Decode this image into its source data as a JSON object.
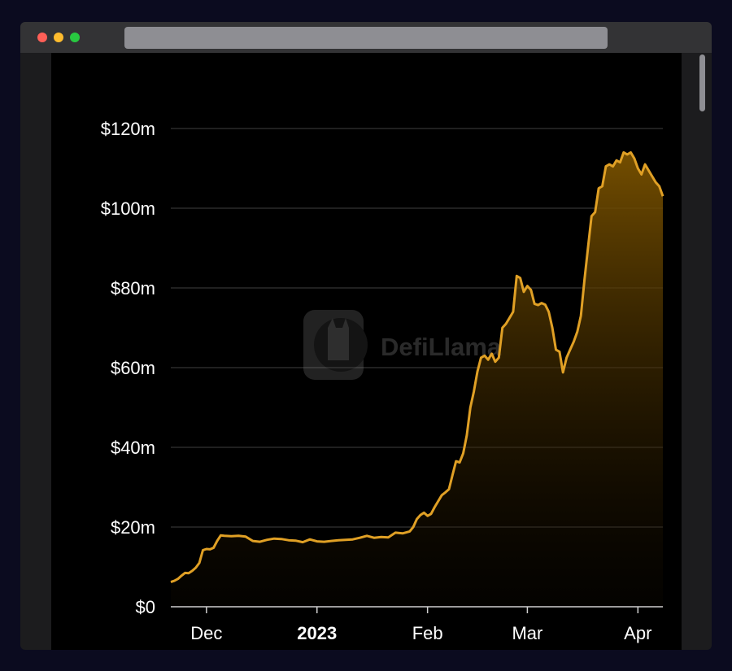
{
  "window": {
    "url": "",
    "controls": [
      "close",
      "minimize",
      "zoom"
    ]
  },
  "watermark": {
    "text": "DefiLlama",
    "logo_icon": "llama-logo-icon"
  },
  "colors": {
    "line": "#e0a025",
    "area_top": "#7a5200",
    "background": "#000000",
    "grid": "#2a2a2a",
    "text": "#ffffff"
  },
  "chart_data": {
    "type": "area",
    "title": "",
    "xlabel": "",
    "ylabel": "",
    "ylim": [
      0,
      120000000
    ],
    "xlim": [
      "2022-11-21",
      "2023-04-08"
    ],
    "grid": true,
    "legend": "none",
    "y_ticks": [
      {
        "value": 0,
        "label": "$0"
      },
      {
        "value": 20000000,
        "label": "$20m"
      },
      {
        "value": 40000000,
        "label": "$40m"
      },
      {
        "value": 60000000,
        "label": "$60m"
      },
      {
        "value": 80000000,
        "label": "$80m"
      },
      {
        "value": 100000000,
        "label": "$100m"
      },
      {
        "value": 120000000,
        "label": "$120m"
      }
    ],
    "x_ticks": [
      {
        "date": "2022-12-01",
        "label": "Dec",
        "bold": false
      },
      {
        "date": "2023-01-01",
        "label": "2023",
        "bold": true
      },
      {
        "date": "2023-02-01",
        "label": "Feb",
        "bold": false
      },
      {
        "date": "2023-03-01",
        "label": "Mar",
        "bold": false
      },
      {
        "date": "2023-04-01",
        "label": "Apr",
        "bold": false
      }
    ],
    "series": [
      {
        "points": [
          [
            "2022-11-21",
            6200000
          ],
          [
            "2022-11-22",
            6500000
          ],
          [
            "2022-11-23",
            7000000
          ],
          [
            "2022-11-24",
            7800000
          ],
          [
            "2022-11-25",
            8500000
          ],
          [
            "2022-11-26",
            8400000
          ],
          [
            "2022-11-27",
            9000000
          ],
          [
            "2022-11-28",
            9800000
          ],
          [
            "2022-11-29",
            11000000
          ],
          [
            "2022-11-30",
            14200000
          ],
          [
            "2022-12-01",
            14500000
          ],
          [
            "2022-12-02",
            14400000
          ],
          [
            "2022-12-03",
            14800000
          ],
          [
            "2022-12-04",
            16500000
          ],
          [
            "2022-12-05",
            17900000
          ],
          [
            "2022-12-06",
            17800000
          ],
          [
            "2022-12-08",
            17700000
          ],
          [
            "2022-12-10",
            17800000
          ],
          [
            "2022-12-12",
            17600000
          ],
          [
            "2022-12-14",
            16500000
          ],
          [
            "2022-12-16",
            16300000
          ],
          [
            "2022-12-18",
            16800000
          ],
          [
            "2022-12-20",
            17100000
          ],
          [
            "2022-12-22",
            17000000
          ],
          [
            "2022-12-24",
            16700000
          ],
          [
            "2022-12-26",
            16600000
          ],
          [
            "2022-12-28",
            16200000
          ],
          [
            "2022-12-30",
            16900000
          ],
          [
            "2023-01-01",
            16400000
          ],
          [
            "2023-01-03",
            16300000
          ],
          [
            "2023-01-05",
            16500000
          ],
          [
            "2023-01-07",
            16700000
          ],
          [
            "2023-01-09",
            16800000
          ],
          [
            "2023-01-11",
            16900000
          ],
          [
            "2023-01-13",
            17300000
          ],
          [
            "2023-01-15",
            17800000
          ],
          [
            "2023-01-17",
            17300000
          ],
          [
            "2023-01-19",
            17500000
          ],
          [
            "2023-01-21",
            17400000
          ],
          [
            "2023-01-23",
            18600000
          ],
          [
            "2023-01-25",
            18400000
          ],
          [
            "2023-01-27",
            18900000
          ],
          [
            "2023-01-28",
            20000000
          ],
          [
            "2023-01-29",
            22000000
          ],
          [
            "2023-01-30",
            23000000
          ],
          [
            "2023-01-31",
            23600000
          ],
          [
            "2023-02-01",
            22800000
          ],
          [
            "2023-02-02",
            23300000
          ],
          [
            "2023-02-03",
            25000000
          ],
          [
            "2023-02-04",
            26500000
          ],
          [
            "2023-02-05",
            28000000
          ],
          [
            "2023-02-06",
            28700000
          ],
          [
            "2023-02-07",
            29500000
          ],
          [
            "2023-02-08",
            33000000
          ],
          [
            "2023-02-09",
            36500000
          ],
          [
            "2023-02-10",
            36200000
          ],
          [
            "2023-02-11",
            38500000
          ],
          [
            "2023-02-12",
            43000000
          ],
          [
            "2023-02-13",
            50000000
          ],
          [
            "2023-02-14",
            54000000
          ],
          [
            "2023-02-15",
            59000000
          ],
          [
            "2023-02-16",
            62500000
          ],
          [
            "2023-02-17",
            63000000
          ],
          [
            "2023-02-18",
            62000000
          ],
          [
            "2023-02-19",
            63500000
          ],
          [
            "2023-02-20",
            61500000
          ],
          [
            "2023-02-21",
            62500000
          ],
          [
            "2023-02-22",
            70000000
          ],
          [
            "2023-02-23",
            71000000
          ],
          [
            "2023-02-24",
            72500000
          ],
          [
            "2023-02-25",
            74000000
          ],
          [
            "2023-02-26",
            83000000
          ],
          [
            "2023-02-27",
            82500000
          ],
          [
            "2023-02-28",
            79000000
          ],
          [
            "2023-03-01",
            80500000
          ],
          [
            "2023-03-02",
            79500000
          ],
          [
            "2023-03-03",
            76000000
          ],
          [
            "2023-03-04",
            75700000
          ],
          [
            "2023-03-05",
            76200000
          ],
          [
            "2023-03-06",
            75800000
          ],
          [
            "2023-03-07",
            74000000
          ],
          [
            "2023-03-08",
            70000000
          ],
          [
            "2023-03-09",
            64500000
          ],
          [
            "2023-03-10",
            64000000
          ],
          [
            "2023-03-11",
            58800000
          ],
          [
            "2023-03-12",
            62500000
          ],
          [
            "2023-03-13",
            64500000
          ],
          [
            "2023-03-14",
            66500000
          ],
          [
            "2023-03-15",
            69000000
          ],
          [
            "2023-03-16",
            73000000
          ],
          [
            "2023-03-17",
            82000000
          ],
          [
            "2023-03-18",
            90000000
          ],
          [
            "2023-03-19",
            98000000
          ],
          [
            "2023-03-20",
            99000000
          ],
          [
            "2023-03-21",
            105000000
          ],
          [
            "2023-03-22",
            105500000
          ],
          [
            "2023-03-23",
            110500000
          ],
          [
            "2023-03-24",
            111000000
          ],
          [
            "2023-03-25",
            110500000
          ],
          [
            "2023-03-26",
            112000000
          ],
          [
            "2023-03-27",
            111500000
          ],
          [
            "2023-03-28",
            114000000
          ],
          [
            "2023-03-29",
            113500000
          ],
          [
            "2023-03-30",
            114000000
          ],
          [
            "2023-03-31",
            112500000
          ],
          [
            "2023-04-01",
            110000000
          ],
          [
            "2023-04-02",
            108500000
          ],
          [
            "2023-04-03",
            111000000
          ],
          [
            "2023-04-04",
            109500000
          ],
          [
            "2023-04-05",
            108000000
          ],
          [
            "2023-04-06",
            106500000
          ],
          [
            "2023-04-07",
            105500000
          ],
          [
            "2023-04-08",
            103000000
          ]
        ]
      }
    ]
  }
}
